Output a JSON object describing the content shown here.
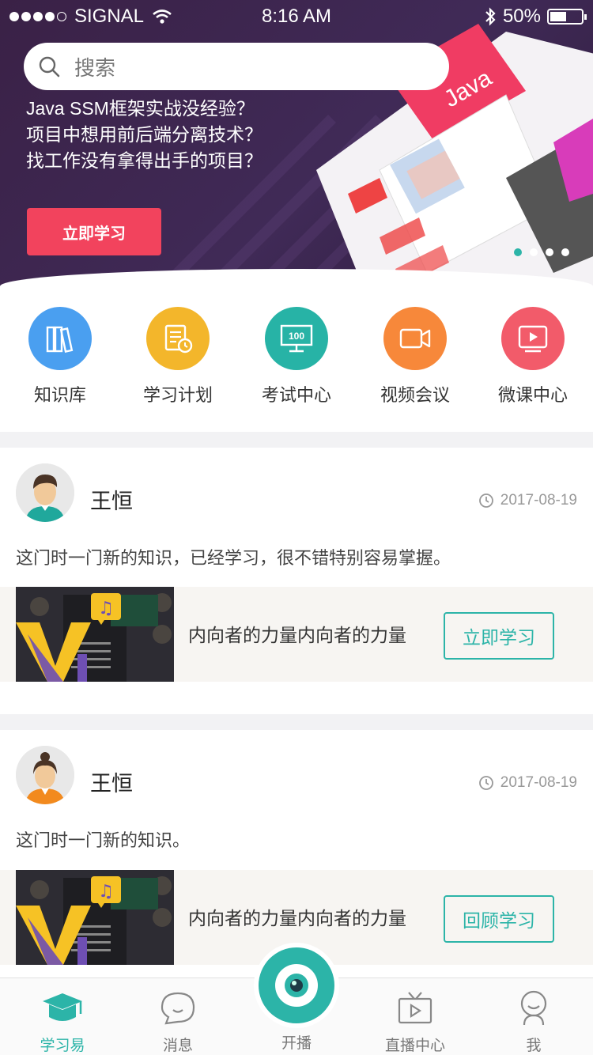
{
  "status_bar": {
    "carrier": "SIGNAL",
    "time": "8:16 AM",
    "battery": "50%"
  },
  "search": {
    "placeholder": "搜索"
  },
  "banner": {
    "lines": [
      "Java SSM框架实战没经验？",
      "项目中想用前后端分离技术？",
      "找工作没有拿得出手的项目？"
    ],
    "button": "立即学习",
    "slide_count": 4,
    "active_slide": 1
  },
  "quick_nav": [
    {
      "label": "知识库",
      "icon": "books-icon",
      "color": "#4a9ff0"
    },
    {
      "label": "学习计划",
      "icon": "plan-clock-icon",
      "color": "#f3b62b"
    },
    {
      "label": "考试中心",
      "icon": "exam-100-icon",
      "color": "#27b3a6"
    },
    {
      "label": "视频会议",
      "icon": "video-camera-icon",
      "color": "#f7883a"
    },
    {
      "label": "微课中心",
      "icon": "play-screen-icon",
      "color": "#f25b6a"
    }
  ],
  "posts": [
    {
      "user": "王恒",
      "avatar": "male-avatar-icon",
      "date": "2017-08-19",
      "comment": "这门时一门新的知识，已经学习，很不错特别容易掌握。",
      "course_title": "内向者的力量内向者的力量",
      "button": "立即学习"
    },
    {
      "user": "王恒",
      "avatar": "female-avatar-icon",
      "date": "2017-08-19",
      "comment": "这门时一门新的知识。",
      "course_title": "内向者的力量内向者的力量",
      "button": "回顾学习"
    }
  ],
  "tabbar": {
    "items": [
      {
        "label": "学习易",
        "icon": "graduation-cap-icon",
        "active": true
      },
      {
        "label": "消息",
        "icon": "chat-bubble-icon",
        "active": false
      },
      {
        "label": "开播",
        "icon": "camera-lens-icon",
        "active": false
      },
      {
        "label": "直播中心",
        "icon": "tv-icon",
        "active": false
      },
      {
        "label": "我",
        "icon": "user-icon",
        "active": false
      }
    ]
  },
  "colors": {
    "accent": "#2cb4a8",
    "promo_button": "#f2435d",
    "banner_bg": "#3a2146"
  }
}
